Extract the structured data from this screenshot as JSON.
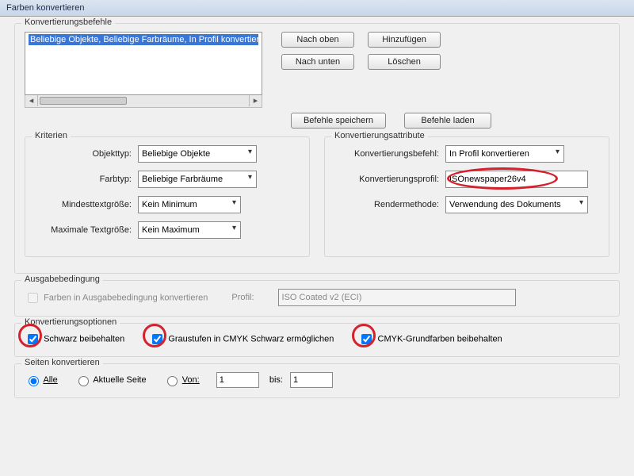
{
  "window": {
    "title": "Farben konvertieren"
  },
  "commands": {
    "group_label": "Konvertierungsbefehle",
    "list_item": "Beliebige Objekte, Beliebige Farbräume, In Profil konvertieren",
    "move_up": "Nach oben",
    "add": "Hinzufügen",
    "move_down": "Nach unten",
    "delete": "Löschen",
    "save": "Befehle speichern",
    "load": "Befehle laden"
  },
  "criteria": {
    "group_label": "Kriterien",
    "object_type_label": "Objekttyp:",
    "object_type": "Beliebige Objekte",
    "color_type_label": "Farbtyp:",
    "color_type": "Beliebige Farbräume",
    "min_text_label": "Mindesttextgröße:",
    "min_text": "Kein Minimum",
    "max_text_label": "Maximale Textgröße:",
    "max_text": "Kein Maximum"
  },
  "attributes": {
    "group_label": "Konvertierungsattribute",
    "cmd_label": "Konvertierungsbefehl:",
    "cmd": "In Profil konvertieren",
    "profile_label": "Konvertierungsprofil:",
    "profile": "ISOnewspaper26v4",
    "render_label": "Rendermethode:",
    "render": "Verwendung des Dokuments"
  },
  "output": {
    "group_label": "Ausgabebedingung",
    "checkbox_label": "Farben in Ausgabebedingung konvertieren",
    "profile_label": "Profil:",
    "profile": "ISO Coated v2 (ECI)"
  },
  "options": {
    "group_label": "Konvertierungsoptionen",
    "preserve_black": "Schwarz beibehalten",
    "gray_to_cmyk_black": "Graustufen in CMYK Schwarz ermöglichen",
    "preserve_cmyk_primaries": "CMYK-Grundfarben beibehalten"
  },
  "pages": {
    "group_label": "Seiten konvertieren",
    "all": "Alle",
    "current": "Aktuelle Seite",
    "from": "Von:",
    "to": "bis:",
    "from_val": "1",
    "to_val": "1"
  }
}
